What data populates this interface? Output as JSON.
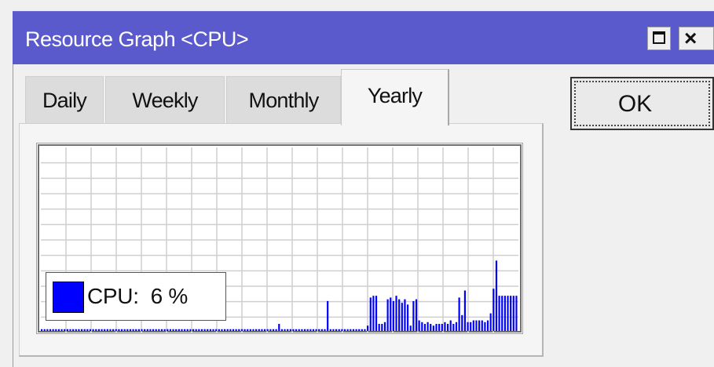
{
  "window": {
    "title": "Resource Graph <CPU>",
    "accent_color": "#5a5acd",
    "title_buttons": [
      "maximize-icon",
      "close-icon"
    ]
  },
  "tabs": [
    {
      "label": "Daily",
      "active": false
    },
    {
      "label": "Weekly",
      "active": false
    },
    {
      "label": "Monthly",
      "active": false
    },
    {
      "label": "Yearly",
      "active": true
    }
  ],
  "ok_button": {
    "label": "OK"
  },
  "legend": {
    "label": "CPU:",
    "value": "6 %",
    "swatch_color": "#0000ff"
  },
  "chart_data": {
    "type": "bar",
    "series_color": "#0000ff",
    "grid": true,
    "ylim": [
      0,
      100
    ],
    "values": [
      1,
      1,
      1,
      1,
      1,
      1,
      1,
      1,
      1,
      1,
      1,
      1,
      1,
      1,
      1,
      1,
      1,
      1,
      1,
      1,
      1,
      1,
      1,
      1,
      1,
      1,
      1,
      1,
      1,
      1,
      1,
      1,
      1,
      1,
      1,
      1,
      1,
      1,
      1,
      1,
      1,
      1,
      1,
      1,
      1,
      1,
      1,
      1,
      1,
      1,
      1,
      1,
      1,
      1,
      1,
      1,
      1,
      1,
      1,
      1,
      1,
      1,
      1,
      1,
      1,
      1,
      1,
      1,
      1,
      1,
      1,
      1,
      1,
      1,
      1,
      1,
      1,
      1,
      1,
      1,
      1,
      1,
      1,
      4,
      1,
      1,
      1,
      1,
      1,
      1,
      1,
      1,
      1,
      1,
      1,
      1,
      1,
      1,
      1,
      1,
      17,
      1,
      1,
      1,
      1,
      1,
      1,
      1,
      1,
      1,
      1,
      1,
      1,
      1,
      3,
      19,
      20,
      20,
      4,
      4,
      5,
      18,
      19,
      17,
      20,
      18,
      16,
      18,
      15,
      3,
      17,
      18,
      6,
      5,
      4,
      5,
      4,
      3,
      4,
      4,
      4,
      5,
      4,
      6,
      4,
      5,
      19,
      9,
      23,
      5,
      5,
      6,
      6,
      6,
      6,
      5,
      6,
      10,
      24,
      40,
      20,
      20,
      20,
      20,
      20,
      20,
      20
    ]
  }
}
